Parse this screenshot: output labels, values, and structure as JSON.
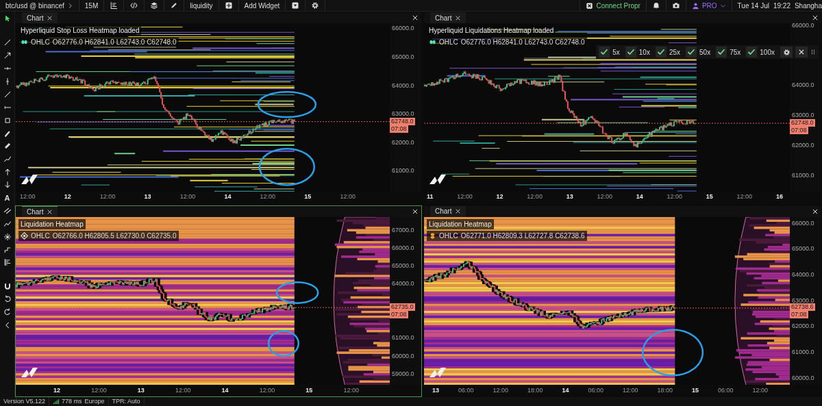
{
  "toolbar": {
    "symbol": "btc/usd @ binancef",
    "interval": "15M",
    "indicator": "liquidity",
    "add_widget": "Add Widget",
    "connect": "Connect Propr",
    "plan": "PRO",
    "date": "Tue 14 Jul",
    "time": "19:22",
    "timezone": "Shangha"
  },
  "tools": [
    {
      "kind": "cursor",
      "selected": true
    },
    {
      "kind": "trend-line",
      "selected": false
    },
    {
      "kind": "arrow",
      "selected": false
    },
    {
      "kind": "horizontal-line",
      "selected": false
    },
    {
      "kind": "vertical-line",
      "selected": false
    },
    {
      "kind": "ray",
      "selected": false
    },
    {
      "kind": "horizontal-ray",
      "selected": false
    },
    {
      "kind": "rectangle",
      "selected": false
    },
    {
      "kind": "brush",
      "selected": false
    },
    {
      "kind": "highlighter",
      "selected": false
    },
    {
      "kind": "path",
      "selected": false
    },
    {
      "kind": "arrow-up",
      "selected": false
    },
    {
      "kind": "arrow-down",
      "selected": false
    },
    {
      "kind": "text",
      "label": "A",
      "selected": false
    },
    {
      "kind": "channel",
      "selected": false
    },
    {
      "kind": "pattern",
      "selected": false
    },
    {
      "kind": "sun",
      "selected": false
    },
    {
      "kind": "step",
      "selected": false
    },
    {
      "kind": "profile",
      "selected": false
    },
    {
      "kind": "magnet",
      "selected": false
    },
    {
      "kind": "undo",
      "selected": false
    },
    {
      "kind": "redo",
      "selected": false
    },
    {
      "kind": "collapse",
      "selected": false
    }
  ],
  "panels": [
    {
      "tab": "Chart",
      "kind": "lines",
      "focused": false,
      "study": "Hyperliquid Stop Loss Heatmap loaded",
      "ohlc_label": "OHLC",
      "ohlc": "O62776.0 H62841.0 L62743.0 C62748.0",
      "price_labels": [
        "66000.0",
        "65000.0",
        "64000.0",
        "63000.0",
        "62000.0",
        "61000.0"
      ],
      "last_price": "62748.0",
      "countdown": "07:08",
      "time_labels": [
        {
          "text": "12:00",
          "major": false
        },
        {
          "text": "12",
          "major": true
        },
        {
          "text": "12:00",
          "major": false
        },
        {
          "text": "13",
          "major": true
        },
        {
          "text": "12:00",
          "major": false
        },
        {
          "text": "14",
          "major": true
        },
        {
          "text": "12:00",
          "major": false
        },
        {
          "text": "15",
          "major": true
        },
        {
          "text": "12:00",
          "major": false
        }
      ]
    },
    {
      "tab": "Chart",
      "kind": "lines",
      "focused": false,
      "study": "Hyperliquid Liquidations Heatmap loaded",
      "ohlc_label": "OHLC",
      "ohlc": "O62776.0 H62841.0 L62743.0 C62748.0",
      "price_labels": [
        "66000.0",
        "64000.0",
        "63000.0",
        "62000.0",
        "61000.0"
      ],
      "last_price": "62748.0",
      "countdown": "07:08",
      "time_labels": [
        {
          "text": "11",
          "major": true
        },
        {
          "text": "12:00",
          "major": false
        },
        {
          "text": "12",
          "major": true
        },
        {
          "text": "12:00",
          "major": false
        },
        {
          "text": "13",
          "major": true
        },
        {
          "text": "12:00",
          "major": false
        },
        {
          "text": "14",
          "major": true
        },
        {
          "text": "12:00",
          "major": false
        },
        {
          "text": "15",
          "major": true
        },
        {
          "text": "12:00",
          "major": false
        },
        {
          "text": "16",
          "major": true
        }
      ],
      "leverage_filters": [
        {
          "label": "5x",
          "checked": true
        },
        {
          "label": "10x",
          "checked": true
        },
        {
          "label": "25x",
          "checked": true
        },
        {
          "label": "50x",
          "checked": true
        },
        {
          "label": "75x",
          "checked": true
        },
        {
          "label": "100x",
          "checked": true
        }
      ]
    },
    {
      "tab": "Chart",
      "kind": "heatmap",
      "focused": true,
      "study": "Liquidation Heatmap",
      "ohlc_label": "OHLC",
      "ohlc": "O62766.0 H62805.5 L62730.0 C62735.0",
      "price_labels": [
        "67000.0",
        "66000.0",
        "65000.0",
        "64000.0",
        "61000.0",
        "60000.0",
        "59000.0"
      ],
      "last_price": "62735.0",
      "countdown": "07:08",
      "time_labels": [
        {
          "text": "12",
          "major": true
        },
        {
          "text": "12:00",
          "major": false
        },
        {
          "text": "13",
          "major": true
        },
        {
          "text": "12:00",
          "major": false
        },
        {
          "text": "14",
          "major": true
        },
        {
          "text": "12:00",
          "major": false
        },
        {
          "text": "15",
          "major": true
        },
        {
          "text": "12:00",
          "major": false
        }
      ]
    },
    {
      "tab": "Chart",
      "kind": "heatmap",
      "focused": false,
      "study": "Liquidation Heatmap",
      "ohlc_label": "OHLC",
      "ohlc": "O62771.0 H62809.3 L62727.8 C62738.6",
      "price_labels": [
        "66000.0",
        "65000.0",
        "64000.0",
        "63000.0",
        "62000.0",
        "61000.0",
        "60000.0"
      ],
      "last_price": "62738.6",
      "countdown": "07:08",
      "time_labels": [
        {
          "text": "13",
          "major": true
        },
        {
          "text": "06:00",
          "major": false
        },
        {
          "text": "12:00",
          "major": false
        },
        {
          "text": "18:00",
          "major": false
        },
        {
          "text": "14",
          "major": true
        },
        {
          "text": "06:00",
          "major": false
        },
        {
          "text": "12:00",
          "major": false
        },
        {
          "text": "18:00",
          "major": false
        },
        {
          "text": "15",
          "major": true
        },
        {
          "text": "06:00",
          "major": false
        },
        {
          "text": "12:00",
          "major": false
        }
      ]
    }
  ],
  "status_bar": {
    "version": "Version V5.122",
    "latency": "778 ms",
    "region": "Europe",
    "tpr": "TPR: Auto"
  }
}
